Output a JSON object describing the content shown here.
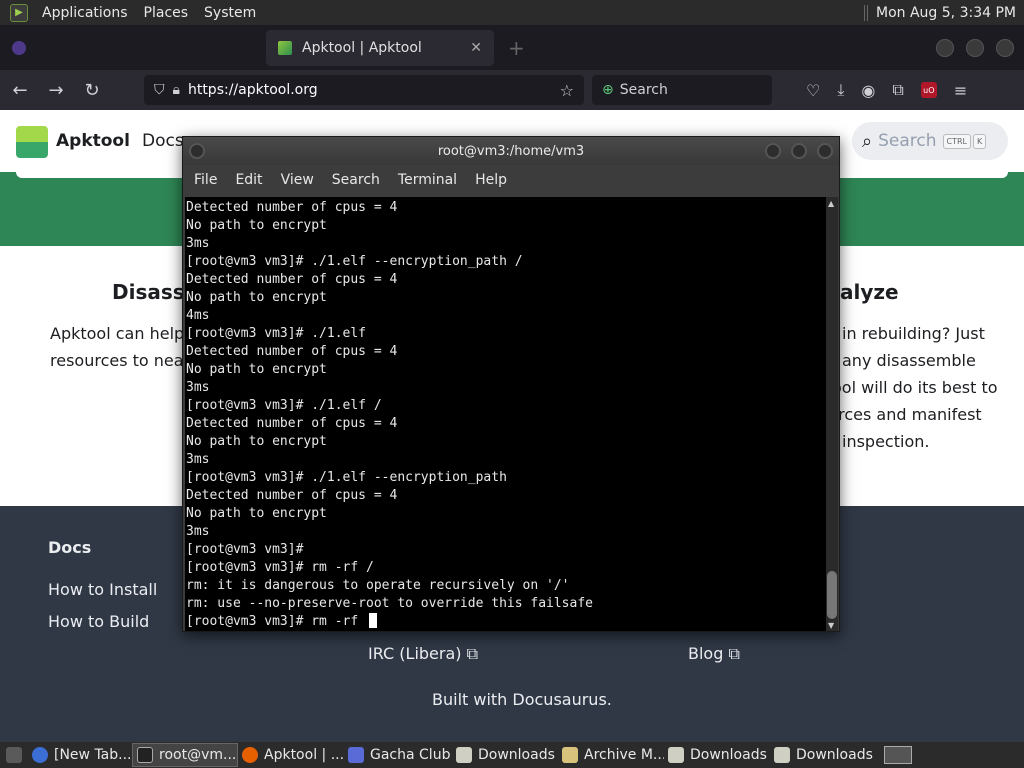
{
  "top_panel": {
    "menus": [
      "Applications",
      "Places",
      "System"
    ],
    "clock": "Mon Aug  5,  3:34 PM"
  },
  "browser": {
    "tabs": [
      {
        "label": "",
        "active": false
      },
      {
        "label": "Apktool | Apktool",
        "active": true
      }
    ],
    "url": "https://apktool.org",
    "search_placeholder": "Search"
  },
  "site": {
    "name": "Apktool",
    "nav_docs": "Docs",
    "search_placeholder": "Search",
    "search_kbd": "CTRL",
    "search_kbd2": "K",
    "feature_left_title": "Disasse",
    "feature_left_lines": [
      "Apktool can help",
      "resources to nearl"
    ],
    "feature_right_title": "alyze",
    "feature_right_lines": [
      "in rebuilding? Just",
      "any disassemble",
      "ool will do its best to",
      "urces and manifest",
      "inspection."
    ],
    "footer": {
      "docs_title": "Docs",
      "how_install": "How to Install",
      "how_build": "How to Build",
      "irc": "IRC (Libera) ⧉",
      "blog": "Blog ⧉",
      "built_with": "Built with Docusaurus."
    }
  },
  "terminal": {
    "title": "root@vm3:/home/vm3",
    "menu": [
      "File",
      "Edit",
      "View",
      "Search",
      "Terminal",
      "Help"
    ],
    "lines": [
      "Detected number of cpus = 4",
      "No path to encrypt",
      "3ms",
      "[root@vm3 vm3]# ./1.elf --encryption_path /",
      "Detected number of cpus = 4",
      "No path to encrypt",
      "4ms",
      "[root@vm3 vm3]# ./1.elf",
      "Detected number of cpus = 4",
      "No path to encrypt",
      "3ms",
      "[root@vm3 vm3]# ./1.elf /",
      "Detected number of cpus = 4",
      "No path to encrypt",
      "3ms",
      "[root@vm3 vm3]# ./1.elf --encryption_path",
      "Detected number of cpus = 4",
      "No path to encrypt",
      "3ms",
      "[root@vm3 vm3]#",
      "[root@vm3 vm3]# rm -rf /",
      "rm: it is dangerous to operate recursively on '/'",
      "rm: use --no-preserve-root to override this failsafe"
    ],
    "prompt_line": "[root@vm3 vm3]# rm -rf "
  },
  "taskbar": {
    "tasks": [
      "[New Tab...",
      "root@vm...",
      "Apktool | ...",
      "Gacha Club",
      "Downloads",
      "Archive M...",
      "Downloads",
      "Downloads"
    ]
  }
}
